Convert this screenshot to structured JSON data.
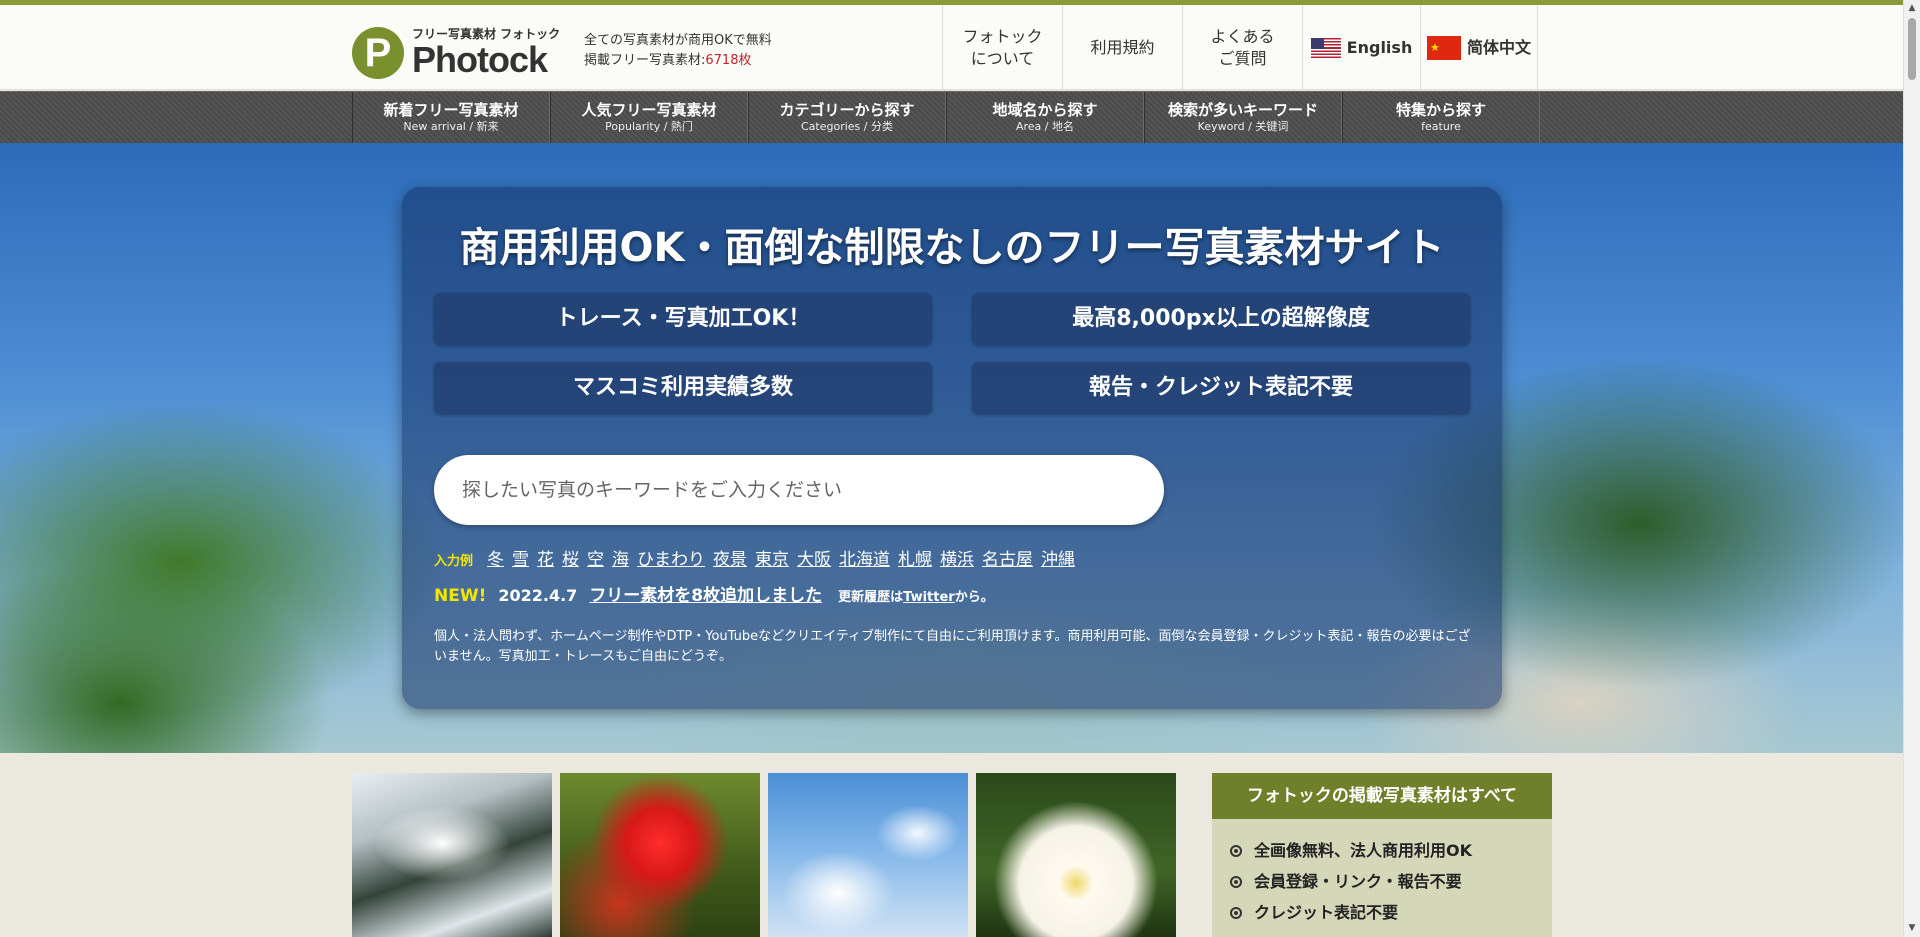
{
  "header": {
    "logo_sub": "フリー写真素材 フォトック",
    "logo_name": "Photock",
    "logo_mark": "P",
    "tagline_line1": "全ての写真素材が商用OKで無料",
    "tagline_prefix": "掲載フリー写真素材:",
    "tagline_count": "6718枚",
    "nav": [
      {
        "label": "フォトック\nについて"
      },
      {
        "label": "利用規約"
      },
      {
        "label": "よくある\nご質問"
      }
    ],
    "lang_english": "English",
    "lang_chinese": "简体中文"
  },
  "catnav": [
    {
      "ja": "新着フリー写真素材",
      "en": "New arrival / 新来"
    },
    {
      "ja": "人気フリー写真素材",
      "en": "Popularity / 熱门"
    },
    {
      "ja": "カテゴリーから探す",
      "en": "Categories / 分类"
    },
    {
      "ja": "地域名から探す",
      "en": "Area / 地名"
    },
    {
      "ja": "検索が多いキーワード",
      "en": "Keyword / 关键词"
    },
    {
      "ja": "特集から探す",
      "en": "feature"
    }
  ],
  "hero": {
    "title": "商用利用OK・面倒な制限なしのフリー写真素材サイト",
    "features": [
      "トレース・写真加工OK！",
      "最高8,000px以上の超解像度",
      "マスコミ利用実績多数",
      "報告・クレジット表記不要"
    ],
    "search_placeholder": "探したい写真のキーワードをご入力ください",
    "examples_label": "入力例",
    "examples": [
      "冬",
      "雪",
      "花",
      "桜",
      "空",
      "海",
      "ひまわり",
      "夜景",
      "東京",
      "大阪",
      "北海道",
      "札幌",
      "横浜",
      "名古屋",
      "沖縄"
    ],
    "news_badge": "NEW!",
    "news_date": "2022.4.7",
    "news_headline": "フリー素材を8枚追加しました",
    "news_history_prefix": "更新履歴は",
    "news_history_link": "Twitter",
    "news_history_suffix": "から。",
    "description": "個人・法人問わず、ホームページ制作やDTP・YouTubeなどクリエイティブ制作にて自由にご利用頂けます。商用利用可能、面倒な会員登録・クレジット表記・報告の必要はございません。写真加工・トレースもご自由にどうぞ。"
  },
  "sidebar": {
    "heading": "フォトックの掲載写真素材はすべて",
    "items": [
      "全画像無料、法人商用利用OK",
      "会員登録・リンク・報告不要",
      "クレジット表記不要"
    ]
  },
  "icons": {
    "up": "scroll-up-arrow",
    "down": "scroll-down-arrow"
  },
  "colors": {
    "accent": "#8a9a3b",
    "brand": "#7a8f2e",
    "count": "#c2272d",
    "highlight": "#f2e600"
  }
}
